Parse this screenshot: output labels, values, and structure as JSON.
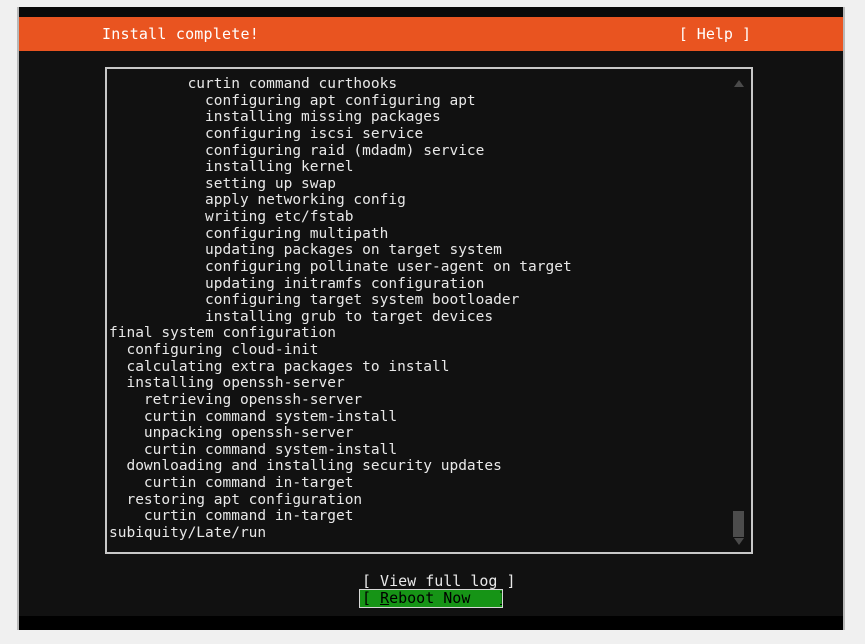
{
  "header": {
    "title": "Install complete!",
    "help_label": "[ Help ]"
  },
  "log": {
    "lines": [
      "         curtin command curthooks",
      "           configuring apt configuring apt",
      "           installing missing packages",
      "           configuring iscsi service",
      "           configuring raid (mdadm) service",
      "           installing kernel",
      "           setting up swap",
      "           apply networking config",
      "           writing etc/fstab",
      "           configuring multipath",
      "           updating packages on target system",
      "           configuring pollinate user-agent on target",
      "           updating initramfs configuration",
      "           configuring target system bootloader",
      "           installing grub to target devices",
      "final system configuration",
      "  configuring cloud-init",
      "  calculating extra packages to install",
      "  installing openssh-server",
      "    retrieving openssh-server",
      "    curtin command system-install",
      "    unpacking openssh-server",
      "    curtin command system-install",
      "  downloading and installing security updates",
      "    curtin command in-target",
      "  restoring apt configuration",
      "    curtin command in-target",
      "subiquity/Late/run"
    ]
  },
  "scrollbar": {
    "up_arrow": "scroll-up-arrow",
    "down_arrow": "scroll-down-arrow",
    "thumb": "scroll-thumb"
  },
  "buttons": {
    "view_full_log": "[ View full log ]",
    "reboot_prefix": "[ ",
    "reboot_accel": "R",
    "reboot_rest": "eboot Now   ]"
  },
  "colors": {
    "header_orange": "#e95420",
    "selection_green": "#169416",
    "terminal_background": "#111111",
    "text": "#e8e8e8",
    "border": "#c8c8c8",
    "page_background": "#f0f0f0"
  }
}
